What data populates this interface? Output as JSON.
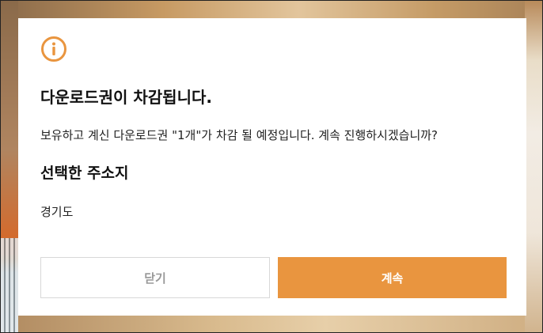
{
  "dialog": {
    "icon": "info-circle-icon",
    "title": "다운로드권이 차감됩니다.",
    "message": "보유하고 계신 다운로드권 \"1개\"가 차감 될 예정입니다. 계속 진행하시겠습니까?",
    "section_title": "선택한 주소지",
    "address": "경기도",
    "close_label": "닫기",
    "continue_label": "계속"
  },
  "colors": {
    "accent": "#e9953f",
    "close_text": "#999999",
    "close_border": "#d8d8d8"
  }
}
